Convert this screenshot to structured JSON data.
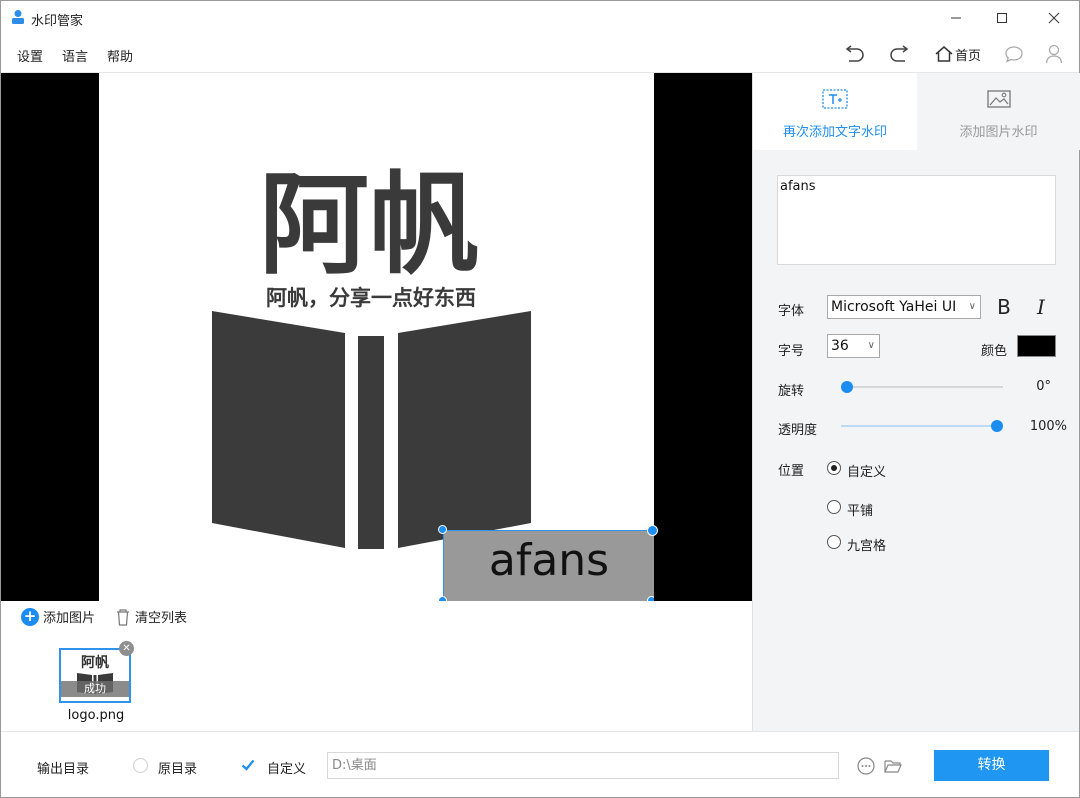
{
  "window": {
    "title": "水印管家"
  },
  "menu": {
    "settings": "设置",
    "language": "语言",
    "help": "帮助",
    "home": "首页"
  },
  "preview": {
    "logo_title": "阿帆",
    "logo_slogan": "阿帆，分享一点好东西",
    "watermark_text": "afans"
  },
  "files": {
    "add_label": "添加图片",
    "clear_label": "清空列表",
    "items": [
      {
        "name": "logo.png",
        "status": "成功",
        "thumb_title": "阿帆"
      }
    ]
  },
  "panel": {
    "tab_text": "再次添加文字水印",
    "tab_image": "添加图片水印",
    "text_value": "afans",
    "font_label": "字体",
    "font_value": "Microsoft YaHei UI",
    "size_label": "字号",
    "size_value": "36",
    "color_label": "颜色",
    "color_value": "#000000",
    "rotate_label": "旋转",
    "rotate_value": "0°",
    "rotate_fraction": 0.0,
    "opacity_label": "透明度",
    "opacity_value": "100%",
    "opacity_fraction": 1.0,
    "position_label": "位置",
    "position_options": [
      "自定义",
      "平铺",
      "九宫格"
    ],
    "position_selected": "自定义"
  },
  "bottom": {
    "output_label": "输出目录",
    "option_original": "原目录",
    "option_custom": "自定义",
    "path_placeholder": "D:\\桌面",
    "convert_label": "转换"
  },
  "colors": {
    "accent": "#1e96f2",
    "watermark_bg": "#999999"
  }
}
